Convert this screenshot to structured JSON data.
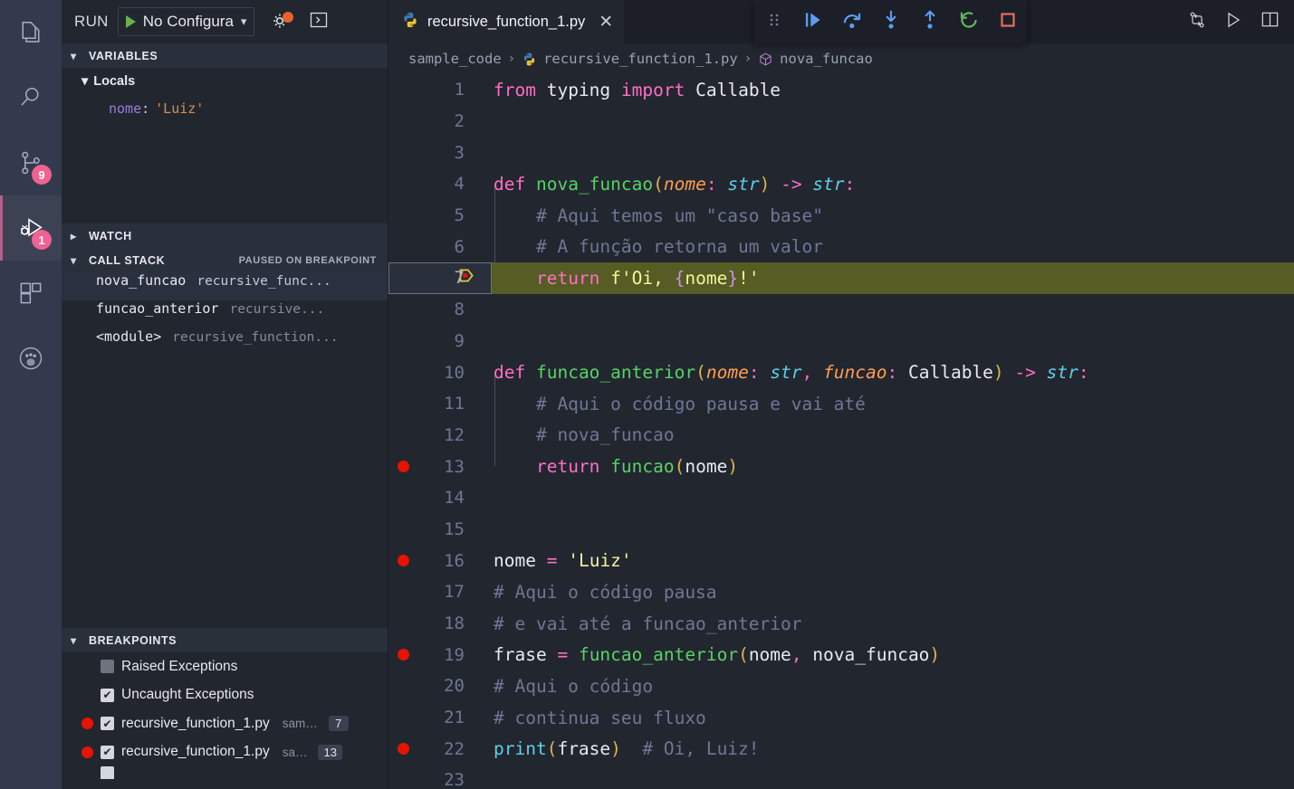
{
  "activity_bar": {
    "items": [
      {
        "name": "explorer",
        "icon": "files-icon",
        "badge": null,
        "active": false
      },
      {
        "name": "search",
        "icon": "search-icon",
        "badge": null,
        "active": false
      },
      {
        "name": "source-control",
        "icon": "source-control-icon",
        "badge": "9",
        "active": false
      },
      {
        "name": "run-and-debug",
        "icon": "run-debug-icon",
        "badge": "1",
        "active": true
      },
      {
        "name": "extensions",
        "icon": "extensions-icon",
        "badge": null,
        "active": false
      },
      {
        "name": "paw",
        "icon": "paw-icon",
        "badge": null,
        "active": false
      }
    ]
  },
  "run_toolbar": {
    "run_label": "RUN",
    "config_name": "No Configura",
    "start_icon": "play-icon",
    "dropdown_icon": "chevron-down-icon",
    "gear_icon": "gear-icon",
    "gear_badge_color": "#e8622a",
    "terminal_icon": "open-debug-console-icon"
  },
  "sidebar": {
    "variables": {
      "title": "VARIABLES",
      "expanded": true,
      "scopes": [
        {
          "label": "Locals",
          "expanded": true,
          "vars": [
            {
              "key": "nome",
              "separator": ":",
              "value": "'Luiz'"
            }
          ]
        }
      ]
    },
    "watch": {
      "title": "WATCH",
      "expanded": false
    },
    "call_stack": {
      "title": "CALL STACK",
      "status": "PAUSED ON BREAKPOINT",
      "expanded": true,
      "frames": [
        {
          "name": "nova_funcao",
          "file": "recursive_func...",
          "selected": true
        },
        {
          "name": "funcao_anterior",
          "file": "recursive...",
          "selected": false
        },
        {
          "name": "<module>",
          "file": "recursive_function...",
          "selected": false
        }
      ]
    },
    "breakpoints": {
      "title": "BREAKPOINTS",
      "expanded": true,
      "items": [
        {
          "dot": false,
          "checked": false,
          "label": "Raised Exceptions",
          "path": "",
          "line": ""
        },
        {
          "dot": false,
          "checked": true,
          "label": "Uncaught Exceptions",
          "path": "",
          "line": ""
        },
        {
          "dot": true,
          "checked": true,
          "label": "recursive_function_1.py",
          "path": "sam…",
          "line": "7"
        },
        {
          "dot": true,
          "checked": true,
          "label": "recursive_function_1.py",
          "path": "sa…",
          "line": "13"
        }
      ]
    }
  },
  "editor": {
    "tab": {
      "title": "recursive_function_1.py",
      "icon": "python-icon",
      "close_icon": "close-icon"
    },
    "tabbar_actions": [
      {
        "name": "compare-changes",
        "icon": "compare-icon"
      },
      {
        "name": "run-python-file",
        "icon": "play-outline-icon"
      },
      {
        "name": "split-editor",
        "icon": "split-editor-icon"
      }
    ],
    "debug_toolbar": [
      {
        "name": "drag-handle",
        "icon": "grip-icon",
        "color": "#8b90a0"
      },
      {
        "name": "continue",
        "icon": "continue-icon",
        "color": "#5b9df0"
      },
      {
        "name": "step-over",
        "icon": "step-over-icon",
        "color": "#5b9df0"
      },
      {
        "name": "step-into",
        "icon": "step-into-icon",
        "color": "#5b9df0"
      },
      {
        "name": "step-out",
        "icon": "step-out-icon",
        "color": "#5b9df0"
      },
      {
        "name": "restart",
        "icon": "restart-icon",
        "color": "#5fb85f"
      },
      {
        "name": "stop",
        "icon": "stop-icon",
        "color": "#e8705f"
      }
    ],
    "breadcrumb": [
      {
        "label": "sample_code",
        "icon": null
      },
      {
        "label": "recursive_function_1.py",
        "icon": "python-icon"
      },
      {
        "label": "nova_funcao",
        "icon": "symbol-method-icon"
      }
    ],
    "current_line": 7,
    "breakpoint_lines": [
      13,
      16,
      19,
      22
    ],
    "lines": [
      {
        "n": 1,
        "text": "from typing import Callable"
      },
      {
        "n": 2,
        "text": ""
      },
      {
        "n": 3,
        "text": ""
      },
      {
        "n": 4,
        "text": "def nova_funcao(nome: str) -> str:"
      },
      {
        "n": 5,
        "text": "    # Aqui temos um \"caso base\""
      },
      {
        "n": 6,
        "text": "    # A função retorna um valor"
      },
      {
        "n": 7,
        "text": "    return f'Oi, {nome}!'"
      },
      {
        "n": 8,
        "text": ""
      },
      {
        "n": 9,
        "text": ""
      },
      {
        "n": 10,
        "text": "def funcao_anterior(nome: str, funcao: Callable) -> str:"
      },
      {
        "n": 11,
        "text": "    # Aqui o código pausa e vai até"
      },
      {
        "n": 12,
        "text": "    # nova_funcao"
      },
      {
        "n": 13,
        "text": "    return funcao(nome)"
      },
      {
        "n": 14,
        "text": ""
      },
      {
        "n": 15,
        "text": ""
      },
      {
        "n": 16,
        "text": "nome = 'Luiz'"
      },
      {
        "n": 17,
        "text": "# Aqui o código pausa"
      },
      {
        "n": 18,
        "text": "# e vai até a funcao_anterior"
      },
      {
        "n": 19,
        "text": "frase = funcao_anterior(nome, nova_funcao)"
      },
      {
        "n": 20,
        "text": "# Aqui o código"
      },
      {
        "n": 21,
        "text": "# continua seu fluxo"
      },
      {
        "n": 22,
        "text": "print(frase)  # Oi, Luiz!"
      },
      {
        "n": 23,
        "text": ""
      }
    ]
  },
  "colors": {
    "editor_bg": "#22262f",
    "sidebar_bg": "#22262f",
    "activitybar_bg": "#343a4d",
    "current_line_bg": "#565c23",
    "breakpoint_red": "#e51400",
    "badge_pink": "#f06292",
    "accent_border": "#b3608a"
  }
}
